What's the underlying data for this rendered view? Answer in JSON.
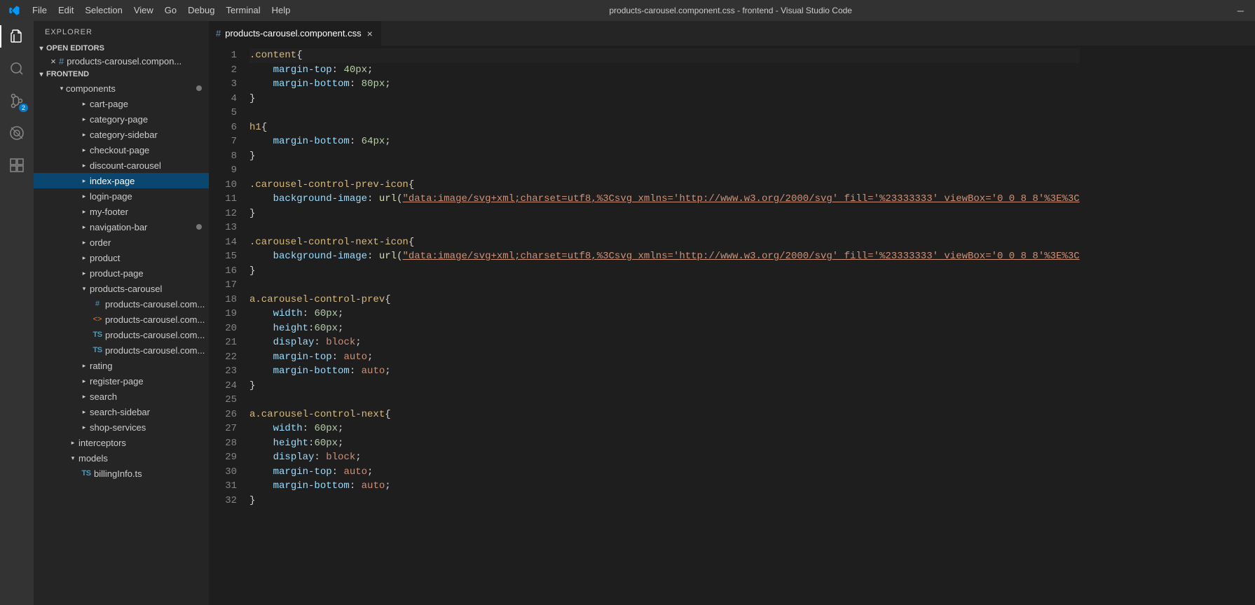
{
  "titleBar": {
    "menus": [
      "File",
      "Edit",
      "Selection",
      "View",
      "Go",
      "Debug",
      "Terminal",
      "Help"
    ],
    "title": "products-carousel.component.css - frontend - Visual Studio Code"
  },
  "activityBar": {
    "scmBadge": "2"
  },
  "sidebar": {
    "title": "EXPLORER",
    "openEditorsLabel": "OPEN EDITORS",
    "openEditor": "products-carousel.compon...",
    "workspaceLabel": "FRONTEND",
    "tree": {
      "components": "components",
      "items": [
        {
          "label": "cart-page",
          "kind": "folder",
          "depth": 3
        },
        {
          "label": "category-page",
          "kind": "folder",
          "depth": 3
        },
        {
          "label": "category-sidebar",
          "kind": "folder",
          "depth": 3
        },
        {
          "label": "checkout-page",
          "kind": "folder",
          "depth": 3
        },
        {
          "label": "discount-carousel",
          "kind": "folder",
          "depth": 3
        },
        {
          "label": "index-page",
          "kind": "folder",
          "depth": 3,
          "selected": true
        },
        {
          "label": "login-page",
          "kind": "folder",
          "depth": 3
        },
        {
          "label": "my-footer",
          "kind": "folder",
          "depth": 3
        },
        {
          "label": "navigation-bar",
          "kind": "folder",
          "depth": 3,
          "dot": true
        },
        {
          "label": "order",
          "kind": "folder",
          "depth": 3
        },
        {
          "label": "product",
          "kind": "folder",
          "depth": 3
        },
        {
          "label": "product-page",
          "kind": "folder",
          "depth": 3
        },
        {
          "label": "products-carousel",
          "kind": "folder",
          "depth": 3,
          "expanded": true
        },
        {
          "label": "products-carousel.com...",
          "kind": "css",
          "depth": 4
        },
        {
          "label": "products-carousel.com...",
          "kind": "html",
          "depth": 4
        },
        {
          "label": "products-carousel.com...",
          "kind": "ts",
          "depth": 4
        },
        {
          "label": "products-carousel.com...",
          "kind": "ts",
          "depth": 4
        },
        {
          "label": "rating",
          "kind": "folder",
          "depth": 3
        },
        {
          "label": "register-page",
          "kind": "folder",
          "depth": 3
        },
        {
          "label": "search",
          "kind": "folder",
          "depth": 3
        },
        {
          "label": "search-sidebar",
          "kind": "folder",
          "depth": 3
        },
        {
          "label": "shop-services",
          "kind": "folder",
          "depth": 3
        },
        {
          "label": "interceptors",
          "kind": "folder",
          "depth": 2
        },
        {
          "label": "models",
          "kind": "folder",
          "depth": 2,
          "expanded": true
        },
        {
          "label": "billingInfo.ts",
          "kind": "ts",
          "depth": 3
        }
      ]
    }
  },
  "tab": {
    "label": "products-carousel.component.css"
  },
  "code": {
    "lines": [
      {
        "n": 1,
        "t": [
          [
            "sel",
            ".content"
          ],
          [
            "punc",
            "{"
          ]
        ]
      },
      {
        "n": 2,
        "t": [
          [
            "ws",
            "    "
          ],
          [
            "prop",
            "margin-top"
          ],
          [
            "punc",
            ": "
          ],
          [
            "num",
            "40px"
          ],
          [
            "punc",
            ";"
          ]
        ]
      },
      {
        "n": 3,
        "t": [
          [
            "ws",
            "    "
          ],
          [
            "prop",
            "margin-bottom"
          ],
          [
            "punc",
            ": "
          ],
          [
            "num",
            "80px"
          ],
          [
            "punc",
            ";"
          ]
        ]
      },
      {
        "n": 4,
        "t": [
          [
            "punc",
            "}"
          ]
        ]
      },
      {
        "n": 5,
        "t": []
      },
      {
        "n": 6,
        "t": [
          [
            "sel",
            "h1"
          ],
          [
            "punc",
            "{"
          ]
        ]
      },
      {
        "n": 7,
        "t": [
          [
            "ws",
            "    "
          ],
          [
            "prop",
            "margin-bottom"
          ],
          [
            "punc",
            ": "
          ],
          [
            "num",
            "64px"
          ],
          [
            "punc",
            ";"
          ]
        ]
      },
      {
        "n": 8,
        "t": [
          [
            "punc",
            "}"
          ]
        ]
      },
      {
        "n": 9,
        "t": []
      },
      {
        "n": 10,
        "t": [
          [
            "sel",
            ".carousel-control-prev-icon"
          ],
          [
            "punc",
            "{"
          ]
        ]
      },
      {
        "n": 11,
        "t": [
          [
            "ws",
            "    "
          ],
          [
            "prop",
            "background-image"
          ],
          [
            "punc",
            ": "
          ],
          [
            "func",
            "url"
          ],
          [
            "punc",
            "("
          ],
          [
            "str",
            "\"data:image/svg+xml;charset=utf8,%3Csvg xmlns='http://www.w3.org/2000/svg' fill='%23333333' viewBox='0 0 8 8'%3E%3C"
          ]
        ]
      },
      {
        "n": 12,
        "t": [
          [
            "punc",
            "}"
          ]
        ]
      },
      {
        "n": 13,
        "t": []
      },
      {
        "n": 14,
        "t": [
          [
            "sel",
            ".carousel-control-next-icon"
          ],
          [
            "punc",
            "{"
          ]
        ]
      },
      {
        "n": 15,
        "t": [
          [
            "ws",
            "    "
          ],
          [
            "prop",
            "background-image"
          ],
          [
            "punc",
            ": "
          ],
          [
            "func",
            "url"
          ],
          [
            "punc",
            "("
          ],
          [
            "str",
            "\"data:image/svg+xml;charset=utf8,%3Csvg xmlns='http://www.w3.org/2000/svg' fill='%23333333' viewBox='0 0 8 8'%3E%3C"
          ]
        ]
      },
      {
        "n": 16,
        "t": [
          [
            "punc",
            "}"
          ]
        ]
      },
      {
        "n": 17,
        "t": []
      },
      {
        "n": 18,
        "t": [
          [
            "sel",
            "a.carousel-control-prev"
          ],
          [
            "punc",
            "{"
          ]
        ]
      },
      {
        "n": 19,
        "t": [
          [
            "ws",
            "    "
          ],
          [
            "prop",
            "width"
          ],
          [
            "punc",
            ": "
          ],
          [
            "num",
            "60px"
          ],
          [
            "punc",
            ";"
          ]
        ]
      },
      {
        "n": 20,
        "t": [
          [
            "ws",
            "    "
          ],
          [
            "prop",
            "height"
          ],
          [
            "punc",
            ":"
          ],
          [
            "num",
            "60px"
          ],
          [
            "punc",
            ";"
          ]
        ]
      },
      {
        "n": 21,
        "t": [
          [
            "ws",
            "    "
          ],
          [
            "prop",
            "display"
          ],
          [
            "punc",
            ": "
          ],
          [
            "kw",
            "block"
          ],
          [
            "punc",
            ";"
          ]
        ]
      },
      {
        "n": 22,
        "t": [
          [
            "ws",
            "    "
          ],
          [
            "prop",
            "margin-top"
          ],
          [
            "punc",
            ": "
          ],
          [
            "kw",
            "auto"
          ],
          [
            "punc",
            ";"
          ]
        ]
      },
      {
        "n": 23,
        "t": [
          [
            "ws",
            "    "
          ],
          [
            "prop",
            "margin-bottom"
          ],
          [
            "punc",
            ": "
          ],
          [
            "kw",
            "auto"
          ],
          [
            "punc",
            ";"
          ]
        ]
      },
      {
        "n": 24,
        "t": [
          [
            "punc",
            "}"
          ]
        ]
      },
      {
        "n": 25,
        "t": []
      },
      {
        "n": 26,
        "t": [
          [
            "sel",
            "a.carousel-control-next"
          ],
          [
            "punc",
            "{"
          ]
        ]
      },
      {
        "n": 27,
        "t": [
          [
            "ws",
            "    "
          ],
          [
            "prop",
            "width"
          ],
          [
            "punc",
            ": "
          ],
          [
            "num",
            "60px"
          ],
          [
            "punc",
            ";"
          ]
        ]
      },
      {
        "n": 28,
        "t": [
          [
            "ws",
            "    "
          ],
          [
            "prop",
            "height"
          ],
          [
            "punc",
            ":"
          ],
          [
            "num",
            "60px"
          ],
          [
            "punc",
            ";"
          ]
        ]
      },
      {
        "n": 29,
        "t": [
          [
            "ws",
            "    "
          ],
          [
            "prop",
            "display"
          ],
          [
            "punc",
            ": "
          ],
          [
            "kw",
            "block"
          ],
          [
            "punc",
            ";"
          ]
        ]
      },
      {
        "n": 30,
        "t": [
          [
            "ws",
            "    "
          ],
          [
            "prop",
            "margin-top"
          ],
          [
            "punc",
            ": "
          ],
          [
            "kw",
            "auto"
          ],
          [
            "punc",
            ";"
          ]
        ]
      },
      {
        "n": 31,
        "t": [
          [
            "ws",
            "    "
          ],
          [
            "prop",
            "margin-bottom"
          ],
          [
            "punc",
            ": "
          ],
          [
            "kw",
            "auto"
          ],
          [
            "punc",
            ";"
          ]
        ]
      },
      {
        "n": 32,
        "t": [
          [
            "punc",
            "}"
          ]
        ]
      }
    ]
  }
}
